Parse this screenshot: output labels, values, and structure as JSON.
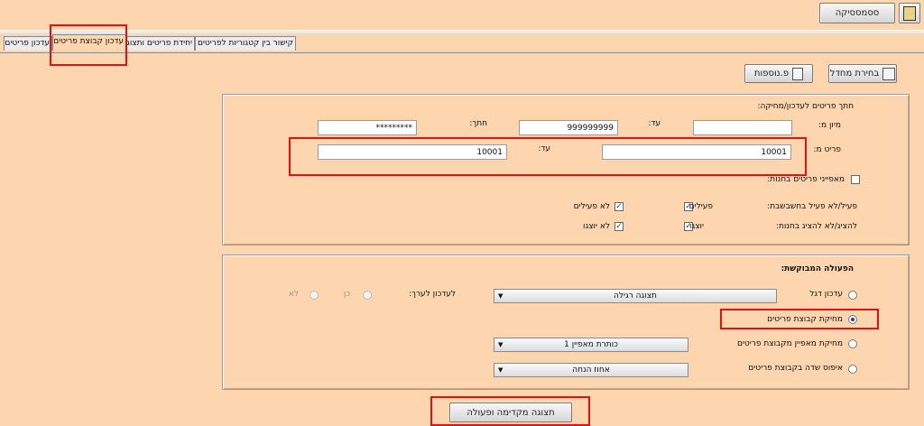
{
  "toolbar": {
    "top_button_label": "ססמססיקה"
  },
  "tabs": [
    {
      "label": "קישור בין קטגוריות לפריטים"
    },
    {
      "label": "יחידת פריטים ותצוגה"
    },
    {
      "label": "עדכון קבוצת פריטים"
    },
    {
      "label": "עדכון פריטים"
    }
  ],
  "actions": {
    "select_label": "בחירת מחדל",
    "extra_label": "פ.נוספות"
  },
  "filter": {
    "title": "חתך פריטים לעדכון/מחיקה:",
    "sort_from_label": "מיון מ:",
    "to_label": "עד:",
    "sort_from_value": "",
    "sort_to_value": "999999999",
    "cut_label": "חתך:",
    "cut_value": "*********",
    "items_from_label": "פריט מ:",
    "items_from_value": "10001",
    "items_to_label": "עד:",
    "items_to_value": "10001",
    "store_chars_label": "מאפייני פריטים בחנות:",
    "active_label": "פעיל/לא פעיל בחשבשבת:",
    "active_opt": "פעילים",
    "inactive_opt": "לא פעילים",
    "show_label": "להציג/לא להציג בחנות:",
    "show_opt": "יוצגו",
    "noshow_opt": "לא יוצגו"
  },
  "operation": {
    "title": "הפעולה המבוקשת:",
    "update_label": "עדכון דגל",
    "update_select": "תצוגה רגילה",
    "update_value_label": "לעדכון לערך:",
    "yes_label": "כן",
    "no_label": "לא",
    "delete_group_label": "מחיקת קבוצת פריטים",
    "delete_char_label": "מחיקת מאפיין מקבוצת פריטים",
    "delete_char_select": "כותרת מאפיין 1",
    "reset_field_label": "איפוס שדה בקבוצת פריטים",
    "reset_field_select": "אחוז הנחה"
  },
  "preview_button": "תצוגה מקדימה ופעולה"
}
